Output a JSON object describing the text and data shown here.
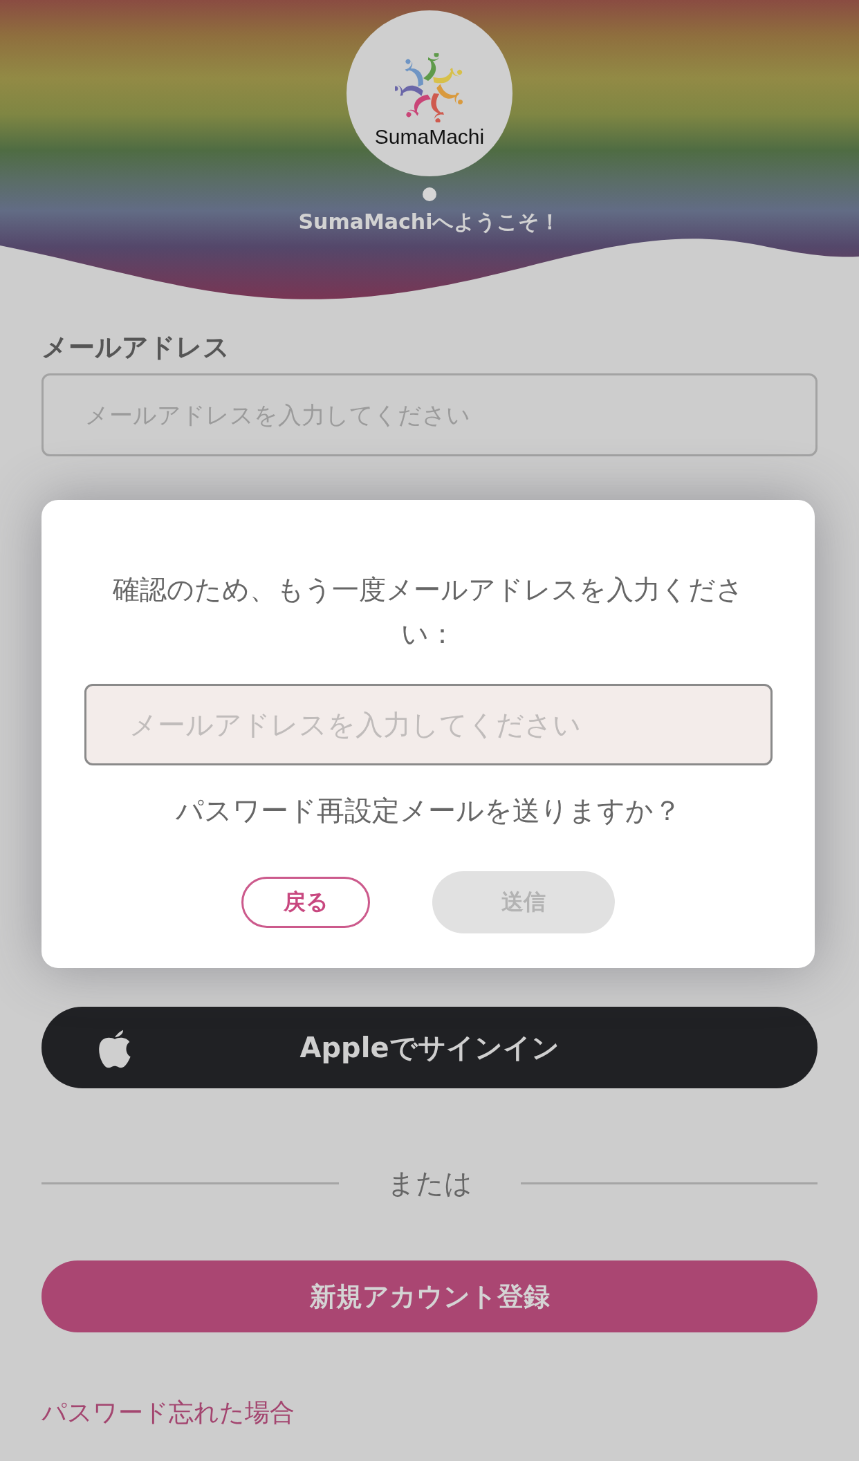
{
  "header": {
    "logo_text": "SumaMachi",
    "welcome": "SumaMachiへようこそ！"
  },
  "email": {
    "label": "メールアドレス",
    "placeholder": "メールアドレスを入力してください"
  },
  "dialog": {
    "message": "確認のため、もう一度メールアドレスを入力ください：",
    "placeholder": "メールアドレスを入力してください",
    "question": "パスワード再設定メールを送りますか？",
    "buttons": [
      {
        "label": "戻る",
        "kind": "outline",
        "disabled": false
      },
      {
        "label": "送信",
        "kind": "filled",
        "disabled": true
      }
    ]
  },
  "apple_button": {
    "label": "Appleでサインイン"
  },
  "divider": "または",
  "register_button": {
    "label": "新規アカウント登録"
  },
  "forgot_link": "パスワード忘れた場合"
}
